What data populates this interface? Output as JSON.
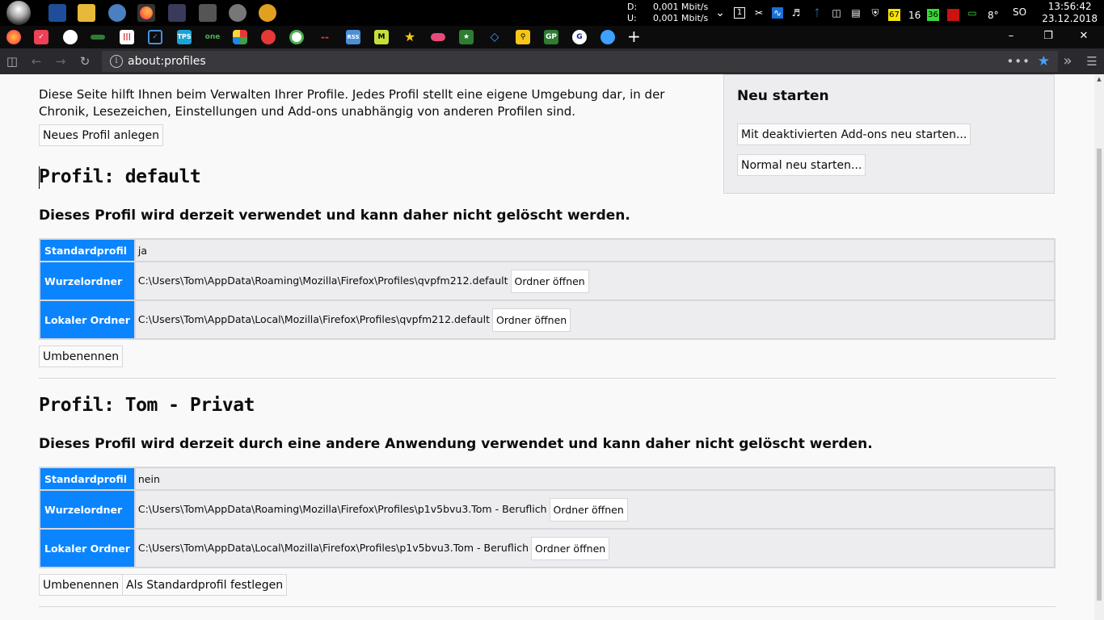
{
  "taskbar": {
    "net": {
      "down_label": "D:",
      "down_value": "0,001 Mbit/s",
      "up_label": "U:",
      "up_value": "0,001 Mbit/s"
    },
    "tray_numbers": {
      "box1": "1",
      "cpu_temp": "67",
      "val16": "16",
      "val36": "36",
      "temp": "8°"
    },
    "lang": "SO",
    "time": "13:56:42",
    "date": "23.12.2018"
  },
  "browser": {
    "url": "about:profiles",
    "colors": {
      "accent": "#0a84ff",
      "toolbar": "#2a2a2e",
      "tabstrip": "#0c0c0d"
    }
  },
  "page": {
    "intro": "Diese Seite hilft Ihnen beim Verwalten Ihrer Profile. Jedes Profil stellt eine eigene Umgebung dar, in der Chronik, Lesezeichen, Einstellungen und Add-ons unabhängig von anderen Profilen sind.",
    "new_profile_button": "Neues Profil anlegen",
    "restart": {
      "title": "Neu starten",
      "addons_button": "Mit deaktivierten Add-ons neu starten...",
      "normal_button": "Normal neu starten..."
    },
    "profiles": [
      {
        "title": "Profil: default",
        "status": "Dieses Profil wird derzeit verwendet und kann daher nicht gelöscht werden.",
        "labels": {
          "default": "Standardprofil",
          "root": "Wurzelordner",
          "local": "Lokaler Ordner"
        },
        "default_value": "ja",
        "root_path": "C:\\Users\\Tom\\AppData\\Roaming\\Mozilla\\Firefox\\Profiles\\qvpfm212.default",
        "local_path": "C:\\Users\\Tom\\AppData\\Local\\Mozilla\\Firefox\\Profiles\\qvpfm212.default",
        "open_folder": "Ordner öffnen",
        "rename_button": "Umbenennen"
      },
      {
        "title": "Profil: Tom - Privat",
        "status": "Dieses Profil wird derzeit durch eine andere Anwendung verwendet und kann daher nicht gelöscht werden.",
        "labels": {
          "default": "Standardprofil",
          "root": "Wurzelordner",
          "local": "Lokaler Ordner"
        },
        "default_value": "nein",
        "root_path": "C:\\Users\\Tom\\AppData\\Roaming\\Mozilla\\Firefox\\Profiles\\p1v5bvu3.Tom - Beruflich",
        "local_path": "C:\\Users\\Tom\\AppData\\Local\\Mozilla\\Firefox\\Profiles\\p1v5bvu3.Tom - Beruflich",
        "open_folder": "Ordner öffnen",
        "rename_button": "Umbenennen",
        "set_default_button": "Als Standardprofil festlegen"
      }
    ]
  }
}
